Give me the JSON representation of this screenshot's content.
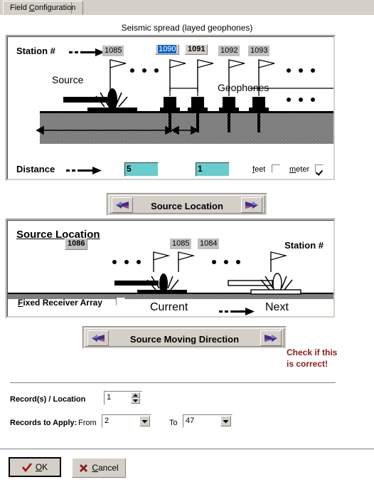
{
  "tab": {
    "label_pre": "Field ",
    "label_key": "C",
    "label_post": "onfiguration"
  },
  "panel1": {
    "caption": "Seismic spread (layed geophones)",
    "station_label": "Station #",
    "source_label": "Source",
    "geophones_label": "Geophones",
    "distance_label": "Distance",
    "stations": [
      "1085",
      "1090",
      "1091",
      "1092",
      "1093"
    ],
    "selected_station": "1090",
    "bold_station": "1091",
    "distance_value_1": "5",
    "distance_value_2": "1",
    "unit_feet": "feet",
    "unit_feet_key": "f",
    "unit_meter": "meter",
    "unit_meter_key": "m",
    "feet_checked": false,
    "meter_checked": true,
    "dots": "• • •"
  },
  "source_location_bar": {
    "title": "Source Location",
    "left_icon": "left-arrow-icon",
    "right_icon": "right-arrow-icon"
  },
  "panel2": {
    "title": "Source Location",
    "badge": "1086",
    "station_label": "Station #",
    "stations": [
      "1085",
      "1084"
    ],
    "fixed_receiver_label_key": "F",
    "fixed_receiver_label": "ixed Receiver Array",
    "fixed_receiver_checked": false,
    "current_label": "Current",
    "next_label": "Next",
    "dots": "• • •"
  },
  "moving_direction_bar": {
    "title": "Source Moving Direction",
    "left_icon": "left-arrow-icon",
    "right_icon": "right-arrow-icon"
  },
  "warning": {
    "line1": "Check if this",
    "line2": "is correct!",
    "color": "#8b1a1a"
  },
  "records": {
    "per_location_label": "Record(s) / Location",
    "per_location_value": "1",
    "apply_label": "Records to Apply:",
    "from_label": "From",
    "from_value": "2",
    "to_label": "To",
    "to_value": "47"
  },
  "buttons": {
    "ok_key": "O",
    "ok_rest": "K",
    "ok_icon": "check-icon",
    "cancel_key": "C",
    "cancel_rest": "ancel",
    "cancel_icon": "cross-icon"
  },
  "colors": {
    "cyan_field": "#66cccc",
    "highlight": "#0a64c8",
    "warn": "#8b1a1a",
    "face": "#d4d0c8"
  }
}
